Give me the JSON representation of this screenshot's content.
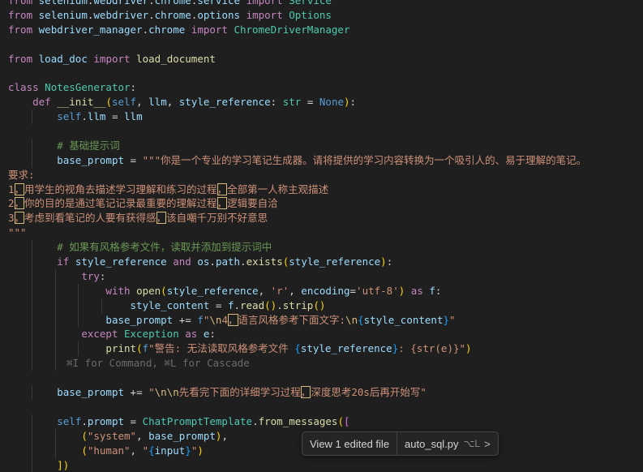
{
  "editor": {
    "inline_hint": "⌘I for Command, ⌘L for Cascade",
    "lines": [
      "from selenium.webdriver.chrome.service import Service",
      "from selenium.webdriver.chrome.options import Options",
      "from webdriver_manager.chrome import ChromeDriverManager",
      "",
      "from load_doc import load_document",
      "",
      "class NotesGenerator:",
      "    def __init__(self, llm, style_reference: str = None):",
      "        self.llm = llm",
      "",
      "        # 基础提示词",
      "        base_prompt = \"\"\"你是一个专业的学习笔记生成器。请将提供的学习内容转换为一个吸引人的、易于理解的笔记。",
      "要求:",
      "1，用学生的视角去描述学习理解和练习的过程，全部第一人称主观描述",
      "2，你的目的是通过笔记记录最重要的理解过程，逻辑要自洽",
      "3，考虑到看笔记的人要有获得感，该自嘲千万别不好意思",
      "\"\"\"",
      "        # 如果有风格参考文件，读取并添加到提示词中",
      "        if style_reference and os.path.exists(style_reference):",
      "            try:",
      "                with open(style_reference, 'r', encoding='utf-8') as f:",
      "                    style_content = f.read().strip()",
      "                base_prompt += f\"\\n4，语言风格参考下面文字:\\n{style_content}\"",
      "            except Exception as e:",
      "                print(f\"警告: 无法读取风格参考文件 {style_reference}: {str(e)}\")",
      "",
      "        base_prompt += \"\\n\\n先看完下面的详细学习过程，深度思考20s后再开始写\"",
      "",
      "        self.prompt = ChatPromptTemplate.from_messages([",
      "            (\"system\", base_prompt),",
      "            (\"human\", \"{input}\")",
      "        ])"
    ]
  },
  "popup": {
    "view_edited_label": "View 1 edited file",
    "file_label": "auto_sql.py",
    "shortcut": "⌥L",
    "chevron": ">"
  },
  "colors": {
    "background": "#1f1f1f",
    "keyword": "#c586c0",
    "class": "#4ec9b0",
    "function": "#dcdcaa",
    "variable": "#9cdcfe",
    "string": "#ce9178",
    "comment": "#6a9955"
  }
}
